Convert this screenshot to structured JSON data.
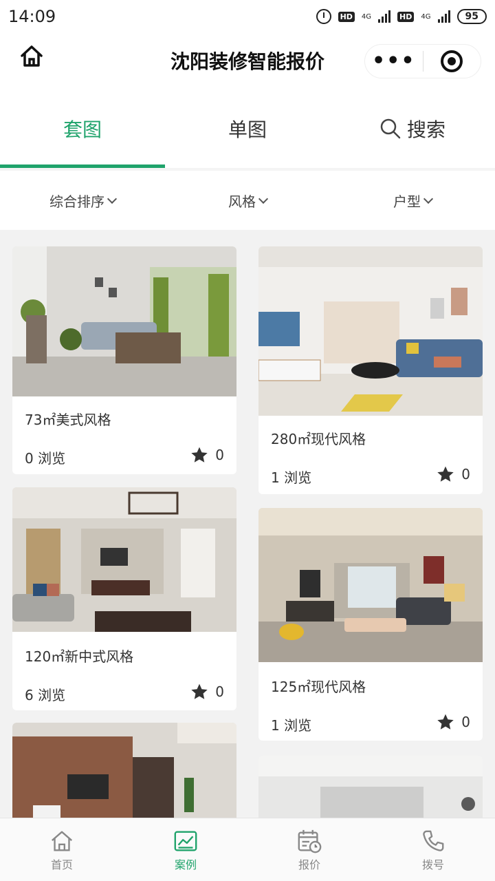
{
  "status": {
    "time": "14:09",
    "hd1": "HD",
    "net1": "4G",
    "hd2": "HD",
    "net2": "4G",
    "battery": "95"
  },
  "header": {
    "title": "沈阳装修智能报价",
    "more": "•••"
  },
  "tabs": [
    {
      "label": "套图",
      "active": true
    },
    {
      "label": "单图",
      "active": false
    },
    {
      "label": "搜索",
      "active": false
    }
  ],
  "filters": [
    {
      "label": "综合排序"
    },
    {
      "label": "风格"
    },
    {
      "label": "户型"
    }
  ],
  "cards": [
    {
      "name": "73㎡美式风格",
      "views": "0 浏览",
      "favs": "0"
    },
    {
      "name": "280㎡现代风格",
      "views": "1 浏览",
      "favs": "0"
    },
    {
      "name": "120㎡新中式风格",
      "views": "6 浏览",
      "favs": "0"
    },
    {
      "name": "125㎡现代风格",
      "views": "1 浏览",
      "favs": "0"
    }
  ],
  "tabbar": [
    {
      "label": "首页",
      "icon": "home-icon"
    },
    {
      "label": "案例",
      "icon": "chart-icon",
      "active": true
    },
    {
      "label": "报价",
      "icon": "calendar-icon"
    },
    {
      "label": "拨号",
      "icon": "phone-icon"
    }
  ],
  "colors": {
    "accent": "#1fa36b",
    "background": "#f2f2f2"
  }
}
